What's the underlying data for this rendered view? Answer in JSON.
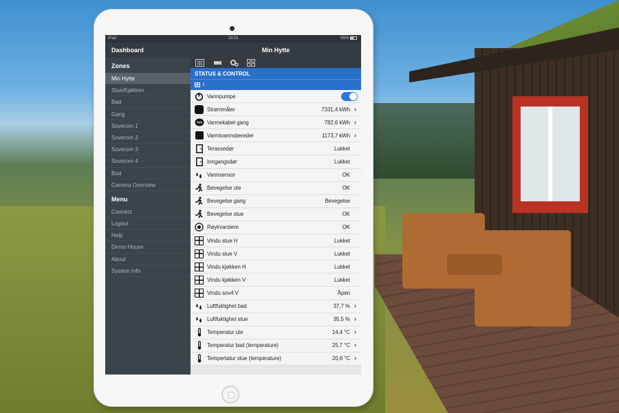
{
  "statusbar": {
    "device": "iPad",
    "time": "19:21",
    "battery": "55%"
  },
  "sidebar": {
    "dashboard": "Dashboard",
    "zones_header": "Zones",
    "zones": [
      "Min Hytte",
      "Stue/Kjøkken",
      "Bad",
      "Gang",
      "Soverom 1",
      "Soverom 2",
      "Soverom 3",
      "Soverom 4",
      "Bod",
      "Camera Overview"
    ],
    "menu_header": "Menu",
    "menu": [
      "Connect",
      "Logout",
      "Help",
      "Demo House",
      "About",
      "System Info"
    ]
  },
  "main": {
    "title": "Min Hytte",
    "section": "STATUS & CONTROL",
    "sub": "1",
    "rows": [
      {
        "label": "Vannpumpe",
        "value": "",
        "icon": "power-icon",
        "toggle": true,
        "chev": false
      },
      {
        "label": "Strømmåler",
        "value": "7331,4 kWh",
        "icon": "meter-icon",
        "toggle": false,
        "chev": true
      },
      {
        "label": "Varmekabel gang",
        "value": "782,6 kWh",
        "icon": "heat-cable-icon",
        "toggle": false,
        "chev": true
      },
      {
        "label": "Varmtvannsbereder",
        "value": "1173,7 kWh",
        "icon": "boiler-icon",
        "toggle": false,
        "chev": true
      },
      {
        "label": "Terassedør",
        "value": "Lukket",
        "icon": "door-icon",
        "toggle": false,
        "chev": false
      },
      {
        "label": "Inngangsdør",
        "value": "Lukket",
        "icon": "door-icon",
        "toggle": false,
        "chev": false
      },
      {
        "label": "Vannsensor",
        "value": "OK",
        "icon": "water-drop-icon",
        "toggle": false,
        "chev": false
      },
      {
        "label": "Bevegelse ute",
        "value": "OK",
        "icon": "motion-icon",
        "toggle": false,
        "chev": false
      },
      {
        "label": "Bevegelse gang",
        "value": "Bevegelse",
        "icon": "motion-icon",
        "toggle": false,
        "chev": false
      },
      {
        "label": "Bevegelse stue",
        "value": "OK",
        "icon": "motion-icon",
        "toggle": false,
        "chev": false
      },
      {
        "label": "Røykvarslere",
        "value": "OK",
        "icon": "smoke-detector-icon",
        "toggle": false,
        "chev": false
      },
      {
        "label": "Vindu stue H",
        "value": "Lukket",
        "icon": "window-icon",
        "toggle": false,
        "chev": false
      },
      {
        "label": "Vindu stue V",
        "value": "Lukket",
        "icon": "window-icon",
        "toggle": false,
        "chev": false
      },
      {
        "label": "Vindu kjøkken H",
        "value": "Lukket",
        "icon": "window-icon",
        "toggle": false,
        "chev": false
      },
      {
        "label": "Vindu kjøkken V",
        "value": "Lukket",
        "icon": "window-icon",
        "toggle": false,
        "chev": false
      },
      {
        "label": "Vindu sov4 V",
        "value": "Åpen",
        "icon": "window-icon",
        "toggle": false,
        "chev": false
      },
      {
        "label": "Luftfuktighet bad",
        "value": "37,7 %",
        "icon": "humidity-icon",
        "toggle": false,
        "chev": true
      },
      {
        "label": "Luftfuktighet stue",
        "value": "35,5 %",
        "icon": "humidity-icon",
        "toggle": false,
        "chev": true
      },
      {
        "label": "Temperatur ute",
        "value": "14,4 °C",
        "icon": "thermometer-icon",
        "toggle": false,
        "chev": true
      },
      {
        "label": "Temperatur bad (temperature)",
        "value": "25,7 °C",
        "icon": "thermometer-icon",
        "toggle": false,
        "chev": true
      },
      {
        "label": "Tempertatur stue (temperature)",
        "value": "20,6 °C",
        "icon": "thermometer-icon",
        "toggle": false,
        "chev": true
      }
    ]
  },
  "colors": {
    "accent": "#2a6fc8",
    "sidebar": "#3c444b",
    "selected": "#5a6269"
  }
}
